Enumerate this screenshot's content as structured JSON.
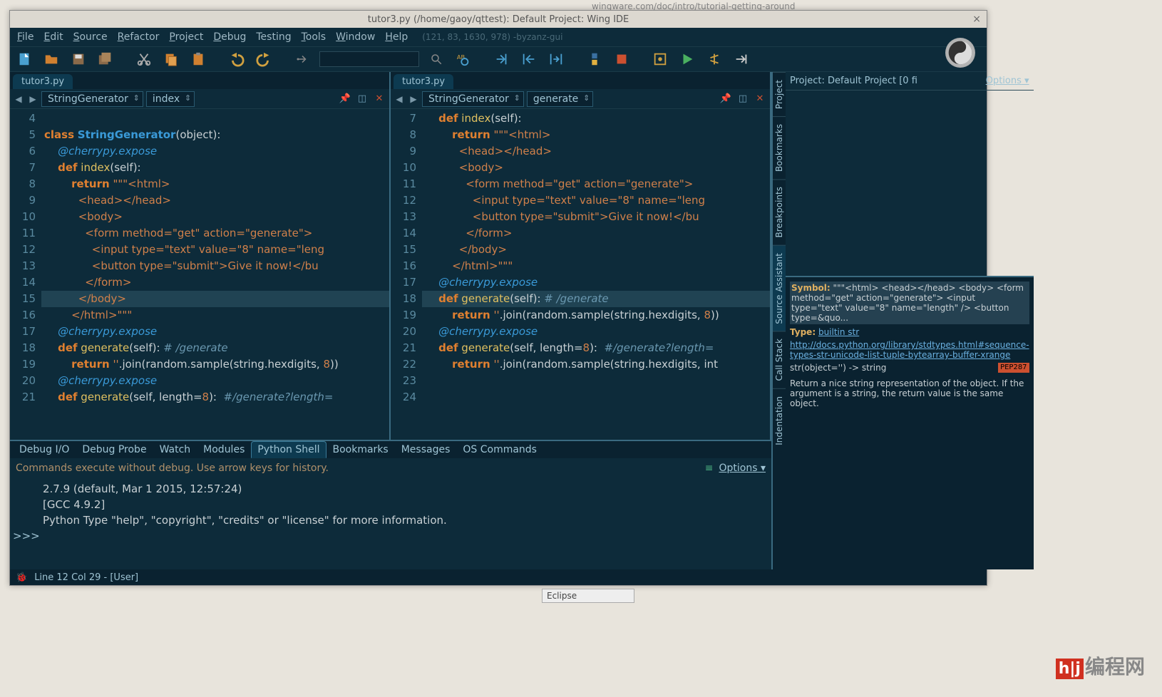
{
  "partial_url": "wingware.com/doc/intro/tutorial-getting-around",
  "title": "tutor3.py (/home/gaoy/qttest): Default Project: Wing IDE",
  "menu": [
    "File",
    "Edit",
    "Source",
    "Refactor",
    "Project",
    "Debug",
    "Testing",
    "Tools",
    "Window",
    "Help"
  ],
  "menu_extra": "(121, 83, 1630, 978) -byzanz-gui",
  "file_tab": "tutor3.py",
  "nav_left": {
    "class": "StringGenerator",
    "member": "index"
  },
  "nav_right": {
    "class": "StringGenerator",
    "member": "generate"
  },
  "left_lines": [
    4,
    5,
    6,
    7,
    8,
    9,
    10,
    11,
    12,
    13,
    14,
    15,
    16,
    17,
    18,
    19,
    20,
    21
  ],
  "right_lines": [
    7,
    8,
    9,
    10,
    11,
    12,
    13,
    14,
    15,
    16,
    17,
    18,
    19,
    20,
    21,
    22,
    23,
    24
  ],
  "bottom_tabs": [
    "Debug I/O",
    "Debug Probe",
    "Watch",
    "Modules",
    "Python Shell",
    "Bookmarks",
    "Messages",
    "OS Commands"
  ],
  "bottom_active": "Python Shell",
  "shell_hint": "Commands execute without debug.  Use arrow keys for history.",
  "shell_options": "Options",
  "shell_lines": [
    "2.7.9 (default, Mar  1 2015, 12:57:24)",
    "[GCC 4.9.2]",
    "Python Type \"help\", \"copyright\", \"credits\" or \"license\" for more information."
  ],
  "prompt": ">>> ",
  "vtabs": [
    "Project",
    "Bookmarks",
    "Breakpoints",
    "Source Assistant",
    "Call Stack",
    "Indentation"
  ],
  "project_header": "Project: Default Project [0 fi",
  "project_options": "Options",
  "assist": {
    "symbol_label": "Symbol:",
    "symbol_val": "\"\"\"<html> <head></head> <body> <form method=\"get\" action=\"generate\"> <input type=\"text\" value=\"8\" name=\"length\" /> <button type=&quo...",
    "type_label": "Type:",
    "type_val": "builtin str",
    "link": "http://docs.python.org/library/stdtypes.html#sequence-types-str-unicode-list-tuple-bytearray-buffer-xrange",
    "sig": "str(object='') -> string",
    "badge": "PEP287",
    "desc": "Return a nice string representation of the object. If the argument is a string, the return value is the same object."
  },
  "status": "Line 12 Col 29 - [User]",
  "watermark": "编程网",
  "eclipse_tab": "Eclipse",
  "chart_data": null
}
